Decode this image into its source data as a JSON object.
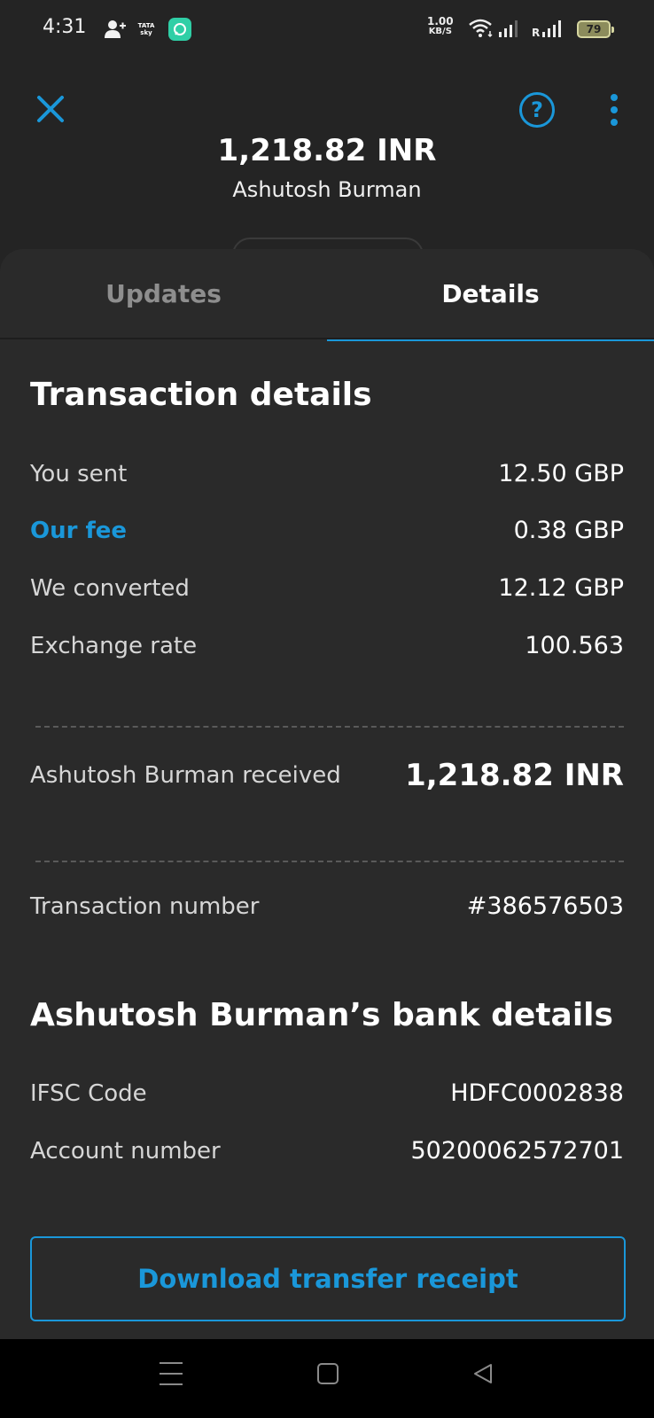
{
  "status_bar": {
    "time": "4:31",
    "tata_sky_line1": "TATA",
    "tata_sky_line2": "sky",
    "speed_value": "1.00",
    "speed_unit": "KB/S",
    "roaming": "R",
    "battery": "79"
  },
  "header": {
    "amount": "1,218.82 INR",
    "recipient_name": "Ashutosh Burman",
    "help_glyph": "?"
  },
  "tabs": [
    {
      "label": "Updates",
      "active": false
    },
    {
      "label": "Details",
      "active": true
    }
  ],
  "transaction_details": {
    "title": "Transaction details",
    "rows": [
      {
        "label": "You sent",
        "value": "12.50 GBP"
      },
      {
        "label": "Our fee",
        "value": "0.38 GBP"
      },
      {
        "label": "We converted",
        "value": "12.12 GBP"
      },
      {
        "label": "Exchange rate",
        "value": "100.563"
      }
    ],
    "received_label": "Ashutosh Burman received",
    "received_value": "1,218.82 INR",
    "transaction_number_label": "Transaction number",
    "transaction_number_value": "#386576503"
  },
  "bank_details": {
    "title": "Ashutosh Burman’s bank details",
    "rows": [
      {
        "label": "IFSC Code",
        "value": "HDFC0002838"
      },
      {
        "label": "Account number",
        "value": "50200062572701"
      }
    ]
  },
  "download_button_label": "Download transfer receipt",
  "colors": {
    "accent": "#1a97d9",
    "background": "#242424",
    "sheet": "#2a2a2a",
    "nav_bar": "#000000"
  },
  "icons": {
    "close": "close-icon",
    "help": "help-circle-icon",
    "more": "more-vertical-icon",
    "nav_menu": "recent-apps-icon",
    "nav_home": "home-icon",
    "nav_back": "back-icon"
  }
}
